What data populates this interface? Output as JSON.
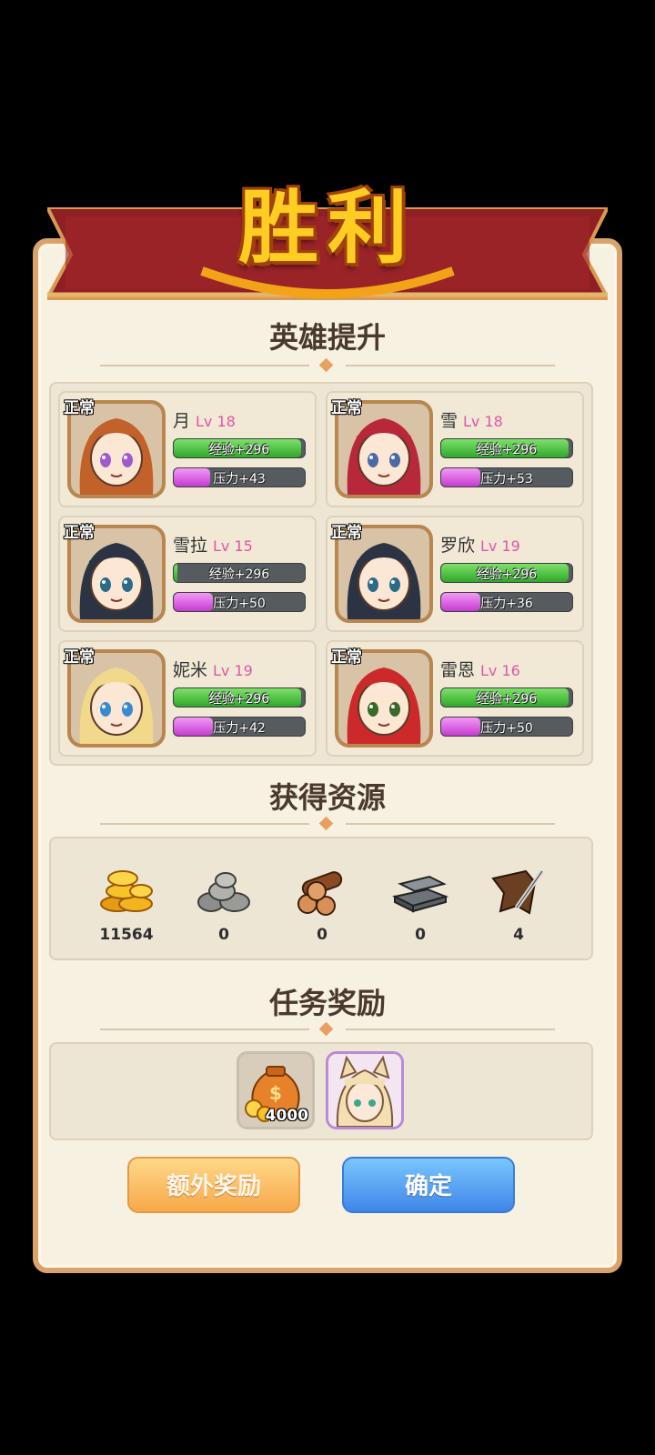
{
  "title": "胜利",
  "sections": {
    "heroes_title": "英雄提升",
    "resources_title": "获得资源",
    "rewards_title": "任务奖励"
  },
  "heroes": [
    {
      "status": "正常",
      "name": "月",
      "level": "Lv 18",
      "exp": "经验+296",
      "exp_fill": 0.97,
      "pressure": "压力+43",
      "pressure_fill": 0.28
    },
    {
      "status": "正常",
      "name": "雪",
      "level": "Lv 18",
      "exp": "经验+296",
      "exp_fill": 0.97,
      "pressure": "压力+53",
      "pressure_fill": 0.3
    },
    {
      "status": "正常",
      "name": "雪拉",
      "level": "Lv 15",
      "exp": "经验+296",
      "exp_fill": 0.03,
      "pressure": "压力+50",
      "pressure_fill": 0.3
    },
    {
      "status": "正常",
      "name": "罗欣",
      "level": "Lv 19",
      "exp": "经验+296",
      "exp_fill": 0.97,
      "pressure": "压力+36",
      "pressure_fill": 0.3
    },
    {
      "status": "正常",
      "name": "妮米",
      "level": "Lv 19",
      "exp": "经验+296",
      "exp_fill": 0.97,
      "pressure": "压力+42",
      "pressure_fill": 0.3
    },
    {
      "status": "正常",
      "name": "雷恩",
      "level": "Lv 16",
      "exp": "经验+296",
      "exp_fill": 0.97,
      "pressure": "压力+50",
      "pressure_fill": 0.3
    }
  ],
  "resources": [
    {
      "icon": "gold-coins-icon",
      "count": "11564"
    },
    {
      "icon": "stone-icon",
      "count": "0"
    },
    {
      "icon": "wood-logs-icon",
      "count": "0"
    },
    {
      "icon": "iron-ingot-icon",
      "count": "0"
    },
    {
      "icon": "leather-hide-icon",
      "count": "4"
    }
  ],
  "rewards": [
    {
      "icon": "money-bag-icon",
      "amount": "4000"
    },
    {
      "icon": "hero-portrait-catgirl-icon",
      "amount": ""
    }
  ],
  "buttons": {
    "extra_reward": "额外奖励",
    "confirm": "确定"
  },
  "colors": {
    "accent_gold": "#ffcc22",
    "banner_red": "#8e1f24",
    "exp_green": "#2fa82a",
    "pressure_pink": "#c43bd0",
    "button_orange": "#f7a84a",
    "button_blue": "#3f86e8"
  }
}
